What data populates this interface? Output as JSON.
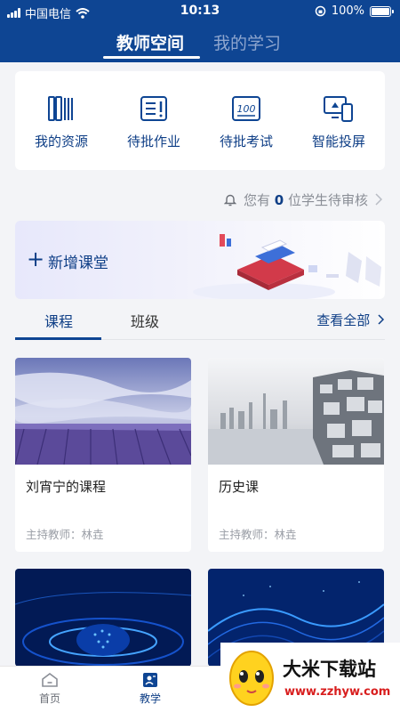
{
  "status_bar": {
    "carrier": "中国电信",
    "time": "10:13",
    "battery": "100%",
    "battery_level": 1.0
  },
  "header": {
    "tabs": [
      {
        "label": "教师空间",
        "active": true
      },
      {
        "label": "我的学习",
        "active": false
      }
    ]
  },
  "quick_actions": [
    {
      "label": "我的资源",
      "icon": "books-icon"
    },
    {
      "label": "待批作业",
      "icon": "homework-icon"
    },
    {
      "label": "待批考试",
      "icon": "exam-icon"
    },
    {
      "label": "智能投屏",
      "icon": "screen-cast-icon"
    }
  ],
  "notice": {
    "prefix": "您有",
    "count": "0",
    "suffix": "位学生待审核"
  },
  "banner": {
    "plus": "+",
    "label": "新增课堂"
  },
  "section_tabs": {
    "tabs": [
      {
        "label": "课程",
        "active": true
      },
      {
        "label": "班级",
        "active": false
      }
    ],
    "view_all": "查看全部"
  },
  "courses": [
    {
      "title": "刘宵宁的课程",
      "teacher": "主持教师：林垚",
      "image": "lavender-field"
    },
    {
      "title": "历史课",
      "teacher": "主持教师：林垚",
      "image": "city-skyline"
    },
    {
      "title": "",
      "teacher": "",
      "image": "blue-tech-globe"
    },
    {
      "title": "",
      "teacher": "",
      "image": "blue-tech-waves"
    }
  ],
  "bottom_nav": [
    {
      "label": "首页",
      "icon": "home-icon",
      "active": false
    },
    {
      "label": "教学",
      "icon": "teaching-icon",
      "active": true
    }
  ],
  "watermark": {
    "title": "大米下载站",
    "url": "www.zzhyw.com"
  },
  "colors": {
    "primary": "#0e4593",
    "accent_text": "#0e3e86",
    "background": "#f3f4f7"
  }
}
